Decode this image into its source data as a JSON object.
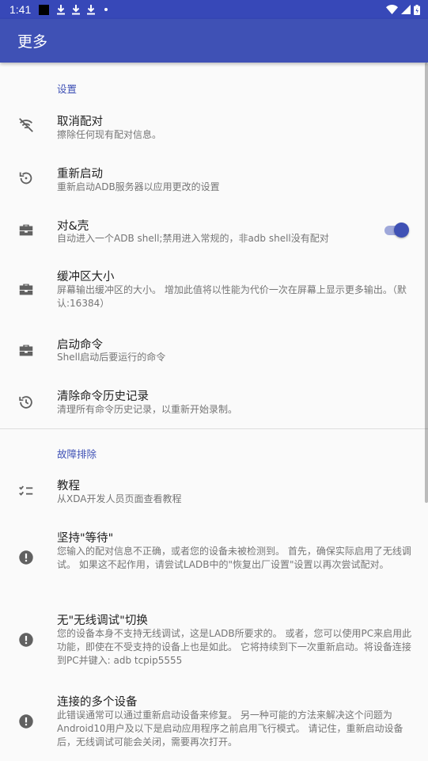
{
  "status_bar": {
    "time": "1:41",
    "icons": [
      "notification-square-icon",
      "download-icon",
      "download-icon",
      "download-icon",
      "dot-icon",
      "wifi-icon",
      "signal-icon",
      "battery-icon"
    ]
  },
  "app_bar": {
    "title": "更多"
  },
  "sections": [
    {
      "header": "设置",
      "items": [
        {
          "icon": "no-pairing-icon",
          "title": "取消配对",
          "summary": "擦除任何现有配对信息。"
        },
        {
          "icon": "restart-icon",
          "title": "重新启动",
          "summary": "重新启动ADB服务器以应用更改的设置"
        },
        {
          "icon": "toolbox-icon",
          "title": "对&壳",
          "summary": "自动进入一个ADB shell;禁用进入常规的，非adb shell没有配对",
          "switch_on": true
        },
        {
          "icon": "toolbox-icon",
          "title": "缓冲区大小",
          "summary": "屏幕输出缓冲区的大小。 增加此值将以性能为代价一次在屏幕上显示更多输出。（默认:16384）"
        },
        {
          "icon": "toolbox-icon",
          "title": "启动命令",
          "summary": "Shell启动后要运行的命令"
        },
        {
          "icon": "history-icon",
          "title": "清除命令历史记录",
          "summary": "清理所有命令历史记录，以重新开始录制。"
        }
      ]
    },
    {
      "header": "故障排除",
      "items": [
        {
          "icon": "checklist-icon",
          "title": "教程",
          "summary": "从XDA开发人员页面查看教程"
        },
        {
          "icon": "alert-icon",
          "title": "坚持\"等待\"",
          "summary": "您输入的配对信息不正确，或者您的设备未被检测到。 首先，确保实际启用了无线调试。 如果这不起作用，请尝试LADB中的\"恢复出厂设置\"设置以再次尝试配对。"
        },
        {
          "icon": "alert-icon",
          "title": "无\"无线调试\"切换",
          "summary": "您的设备本身不支持无线调试，这是LADB所要求的。 或者，您可以使用PC来启用此功能，即使在不受支持的设备上也是如此。 它将持续到下一次重新启动。将设备连接到PC并键入: adb tcpip5555"
        },
        {
          "icon": "alert-icon",
          "title": "连接的多个设备",
          "summary": "此错误通常可以通过重新启动设备来修复。 另一种可能的方法来解决这个问题为Android10用户及以下是启动应用程序之前启用飞行模式。 请记住，重新启动设备后，无线调试可能会关闭，需要再次打开。"
        }
      ]
    }
  ],
  "colors": {
    "primary": "#3f51b5",
    "primary_dark": "#3748b8",
    "accent_track": "#9fa8da"
  }
}
